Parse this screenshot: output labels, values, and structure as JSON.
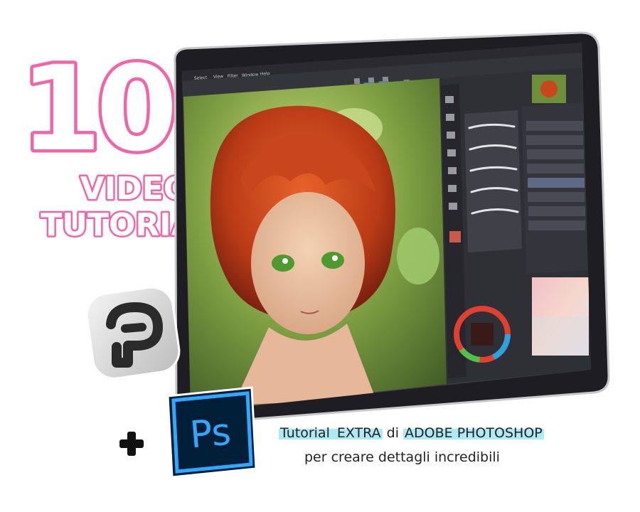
{
  "headline": {
    "number": "10",
    "line1": "VIDEO",
    "line2": "TUTORIAL"
  },
  "promo": {
    "plus": "+",
    "ps_label": "Ps",
    "line1_parts": [
      "Tutorial ",
      "EXTRA",
      " di ",
      "ADOBE PHOTOSHOP"
    ],
    "line2": "per creare dettagli incredibili"
  },
  "app_menu": [
    "Select",
    "View",
    "Filter",
    "Window",
    "Help"
  ],
  "colors": {
    "pink": "#f264a8",
    "highlight": "#aeeaf5",
    "ps_blue": "#31a8ff",
    "ps_dark": "#001e36"
  }
}
